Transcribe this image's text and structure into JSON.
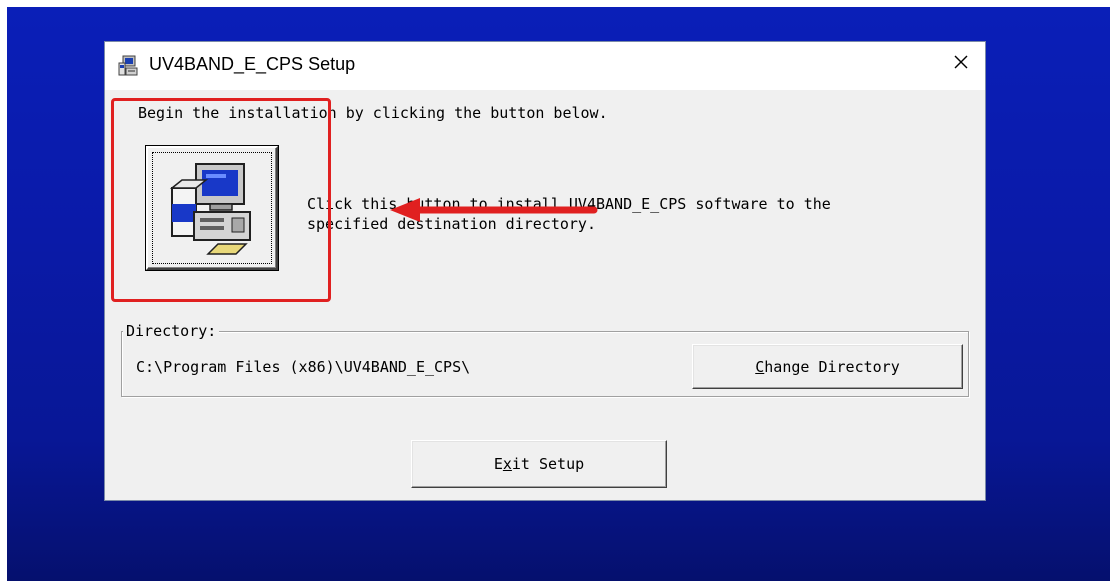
{
  "window": {
    "title": "UV4BAND_E_CPS Setup",
    "close_glyph": "✕",
    "icon": "setup-computer-icon"
  },
  "intro_text": "Begin the installation by clicking the button below.",
  "install": {
    "icon": "install-computer-icon",
    "description_line1": "Click this button to install UV4BAND_E_CPS software to the",
    "description_line2": "specified destination directory."
  },
  "directory": {
    "label": "Directory:",
    "path": "C:\\Program Files (x86)\\UV4BAND_E_CPS\\",
    "change_button": {
      "accel": "C",
      "rest": "hange Directory"
    }
  },
  "exit_button": {
    "pre": "E",
    "accel": "x",
    "rest": "it Setup"
  },
  "annotation": {
    "highlight_color": "#e02020"
  },
  "colors": {
    "desktop": "#0a1aa8",
    "dialog_bg": "#f0f0f0"
  }
}
